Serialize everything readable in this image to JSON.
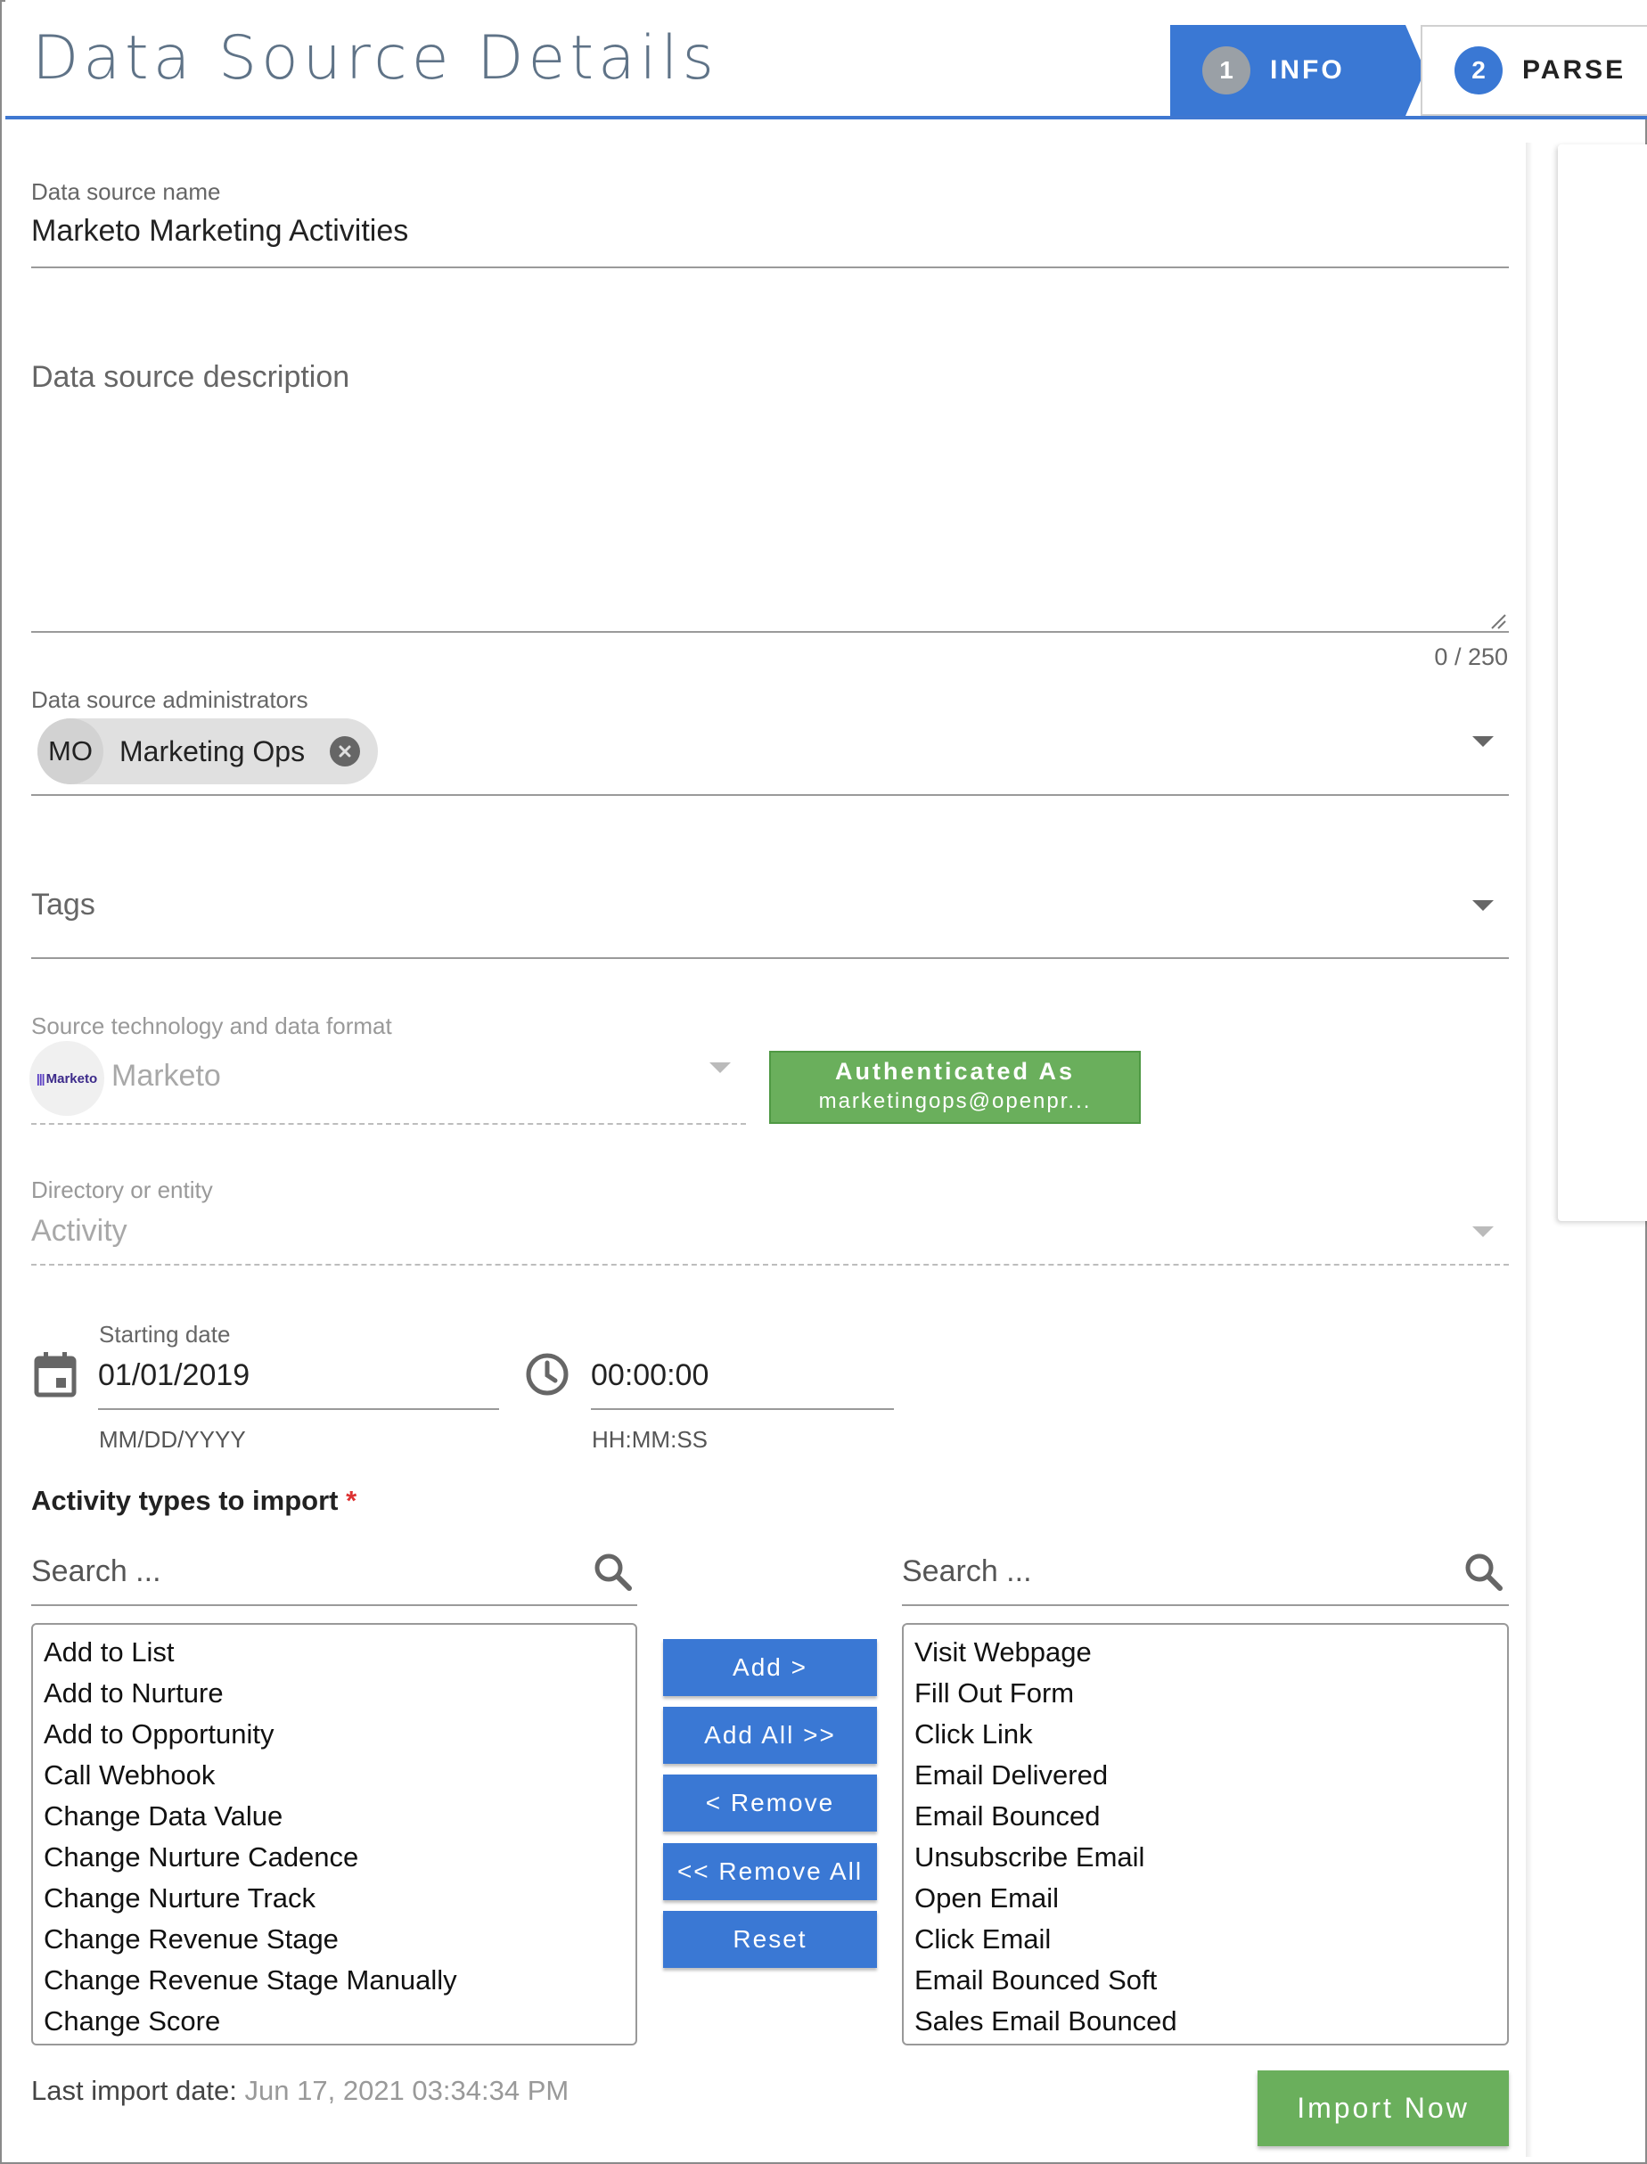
{
  "header": {
    "title": "Data Source Details",
    "steps": [
      {
        "number": "1",
        "label": "INFO"
      },
      {
        "number": "2",
        "label": "PARSE"
      }
    ]
  },
  "form": {
    "name": {
      "label": "Data source name",
      "value": "Marketo Marketing Activities"
    },
    "description": {
      "placeholder": "Data source description",
      "counter": "0 / 250"
    },
    "administrators": {
      "label": "Data source administrators",
      "chip_initials": "MO",
      "chip_label": "Marketing Ops"
    },
    "tags": {
      "label": "Tags"
    },
    "source": {
      "label": "Source technology and data format",
      "logo_text": "Marketo",
      "value": "Marketo"
    },
    "auth": {
      "title": "Authenticated As",
      "account": "marketingops@openpr..."
    },
    "entity": {
      "label": "Directory or entity",
      "value": "Activity"
    },
    "start_date": {
      "label": "Starting date",
      "date": "01/01/2019",
      "date_hint": "MM/DD/YYYY",
      "time": "00:00:00",
      "time_hint": "HH:MM:SS"
    }
  },
  "activity": {
    "title": "Activity types to import",
    "required_mark": "*",
    "left_search_placeholder": "Search ...",
    "right_search_placeholder": "Search ...",
    "available": [
      "Add to List",
      "Add to Nurture",
      "Add to Opportunity",
      "Call Webhook",
      "Change Data Value",
      "Change Nurture Cadence",
      "Change Nurture Track",
      "Change Revenue Stage",
      "Change Revenue Stage Manually",
      "Change Score"
    ],
    "selected": [
      "Visit Webpage",
      "Fill Out Form",
      "Click Link",
      "Email Delivered",
      "Email Bounced",
      "Unsubscribe Email",
      "Open Email",
      "Click Email",
      "Email Bounced Soft",
      "Sales Email Bounced"
    ],
    "buttons": {
      "add": "Add >",
      "add_all": "Add All >>",
      "remove": "< Remove",
      "remove_all": "<< Remove All",
      "reset": "Reset"
    }
  },
  "footer": {
    "last_import_label": "Last import date:",
    "last_import_value": "Jun 17, 2021 03:34:34 PM",
    "import_button": "Import Now"
  },
  "colors": {
    "primary": "#3a78d4",
    "success": "#6aaf5c",
    "title": "#5f7387"
  }
}
